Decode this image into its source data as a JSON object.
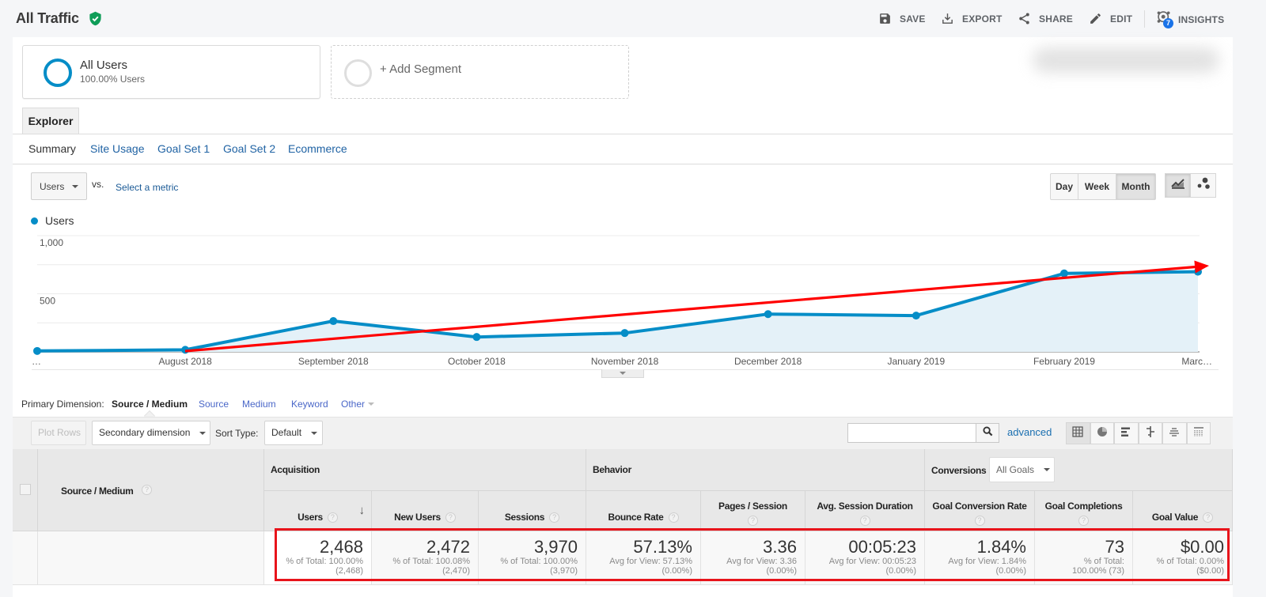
{
  "header": {
    "title": "All Traffic",
    "actions": {
      "save": "SAVE",
      "export": "EXPORT",
      "share": "SHARE",
      "edit": "EDIT",
      "insights": "INSIGHTS",
      "insights_badge": "7"
    }
  },
  "segments": {
    "active_name": "All Users",
    "active_detail": "100.00% Users",
    "add_label": "+ Add Segment"
  },
  "tabs": {
    "explorer": "Explorer"
  },
  "subtabs": [
    "Summary",
    "Site Usage",
    "Goal Set 1",
    "Goal Set 2",
    "Ecommerce"
  ],
  "active_subtab": "Summary",
  "chart_controls": {
    "metric": "Users",
    "vs_label": "vs.",
    "select_metric": "Select a metric",
    "granularity": [
      "Day",
      "Week",
      "Month"
    ],
    "active_granularity": "Month",
    "chart_types": [
      "line-chart-icon",
      "motion-chart-icon"
    ],
    "active_chart_type": "line-chart-icon"
  },
  "chart_data": {
    "type": "line",
    "title": "",
    "xlabel": "",
    "ylabel": "",
    "legend": [
      {
        "name": "Users",
        "color": "#058dc7"
      }
    ],
    "legend_position": "top-left",
    "x": [
      "2018-07-01",
      "2018-08-01",
      "2018-09-01",
      "2018-10-01",
      "2018-11-01",
      "2018-12-01",
      "2019-01-01",
      "2019-02-01",
      "2019-03-01"
    ],
    "x_tick_labels": [
      "…",
      "August 2018",
      "September 2018",
      "October 2018",
      "November 2018",
      "December 2018",
      "January 2019",
      "February 2019",
      "Marc…"
    ],
    "series": [
      {
        "name": "Users",
        "values": [
          8,
          18,
          265,
          128,
          162,
          325,
          312,
          675,
          690
        ],
        "color": "#058dc7",
        "fill": "#e4f1f8"
      }
    ],
    "ylim": [
      0,
      1000
    ],
    "y_ticks": [
      {
        "value": 1000,
        "label": "1,000"
      },
      {
        "value": 500,
        "label": "500"
      }
    ],
    "y_grid": [
      250,
      500,
      750,
      1000
    ],
    "grid": true,
    "annotation": {
      "type": "trend-arrow",
      "color": "#ff0000"
    }
  },
  "primary_dimension": {
    "label": "Primary Dimension:",
    "active": "Source / Medium",
    "options": [
      "Source",
      "Medium",
      "Keyword",
      "Other"
    ]
  },
  "table_controls": {
    "plot_rows": "Plot Rows",
    "secondary_dimension": "Secondary dimension",
    "sort_type_label": "Sort Type:",
    "sort_type": "Default",
    "search_value": "",
    "advanced": "advanced",
    "views": [
      "data-table-icon",
      "pie-chart-icon",
      "performance-icon",
      "comparison-icon",
      "term-cloud-icon",
      "pivot-icon"
    ],
    "active_view": "data-table-icon"
  },
  "table": {
    "dimension_header": "Source / Medium",
    "groups": [
      "Acquisition",
      "Behavior",
      "Conversions"
    ],
    "goal_select": "All Goals",
    "columns": [
      {
        "label": "Users",
        "sorted": "descending"
      },
      {
        "label": "New Users"
      },
      {
        "label": "Sessions"
      },
      {
        "label": "Bounce Rate"
      },
      {
        "label": "Pages / Session"
      },
      {
        "label": "Avg. Session Duration"
      },
      {
        "label": "Goal Conversion Rate"
      },
      {
        "label": "Goal Completions"
      },
      {
        "label": "Goal Value"
      }
    ],
    "totals": [
      {
        "value": "2,468",
        "note": "% of Total: 100.00%",
        "note2": "(2,468)"
      },
      {
        "value": "2,472",
        "note": "% of Total: 100.08%",
        "note2": "(2,470)"
      },
      {
        "value": "3,970",
        "note": "% of Total: 100.00%",
        "note2": "(3,970)"
      },
      {
        "value": "57.13%",
        "note": "Avg for View: 57.13%",
        "note2": "(0.00%)"
      },
      {
        "value": "3.36",
        "note": "Avg for View: 3.36",
        "note2": "(0.00%)"
      },
      {
        "value": "00:05:23",
        "note": "Avg for View: 00:05:23",
        "note2": "(0.00%)"
      },
      {
        "value": "1.84%",
        "note": "Avg for View: 1.84%",
        "note2": "(0.00%)"
      },
      {
        "value": "73",
        "note": "% of Total:",
        "note2": "100.00% (73)"
      },
      {
        "value": "$0.00",
        "note": "% of Total: 0.00%",
        "note2": "($0.00)"
      }
    ]
  },
  "colors": {
    "brand_blue": "#058dc7",
    "link_blue": "#2063a4",
    "verified_green": "#0f9d58",
    "annotation_red": "#e8141b",
    "badge_blue": "#1a73e8"
  }
}
